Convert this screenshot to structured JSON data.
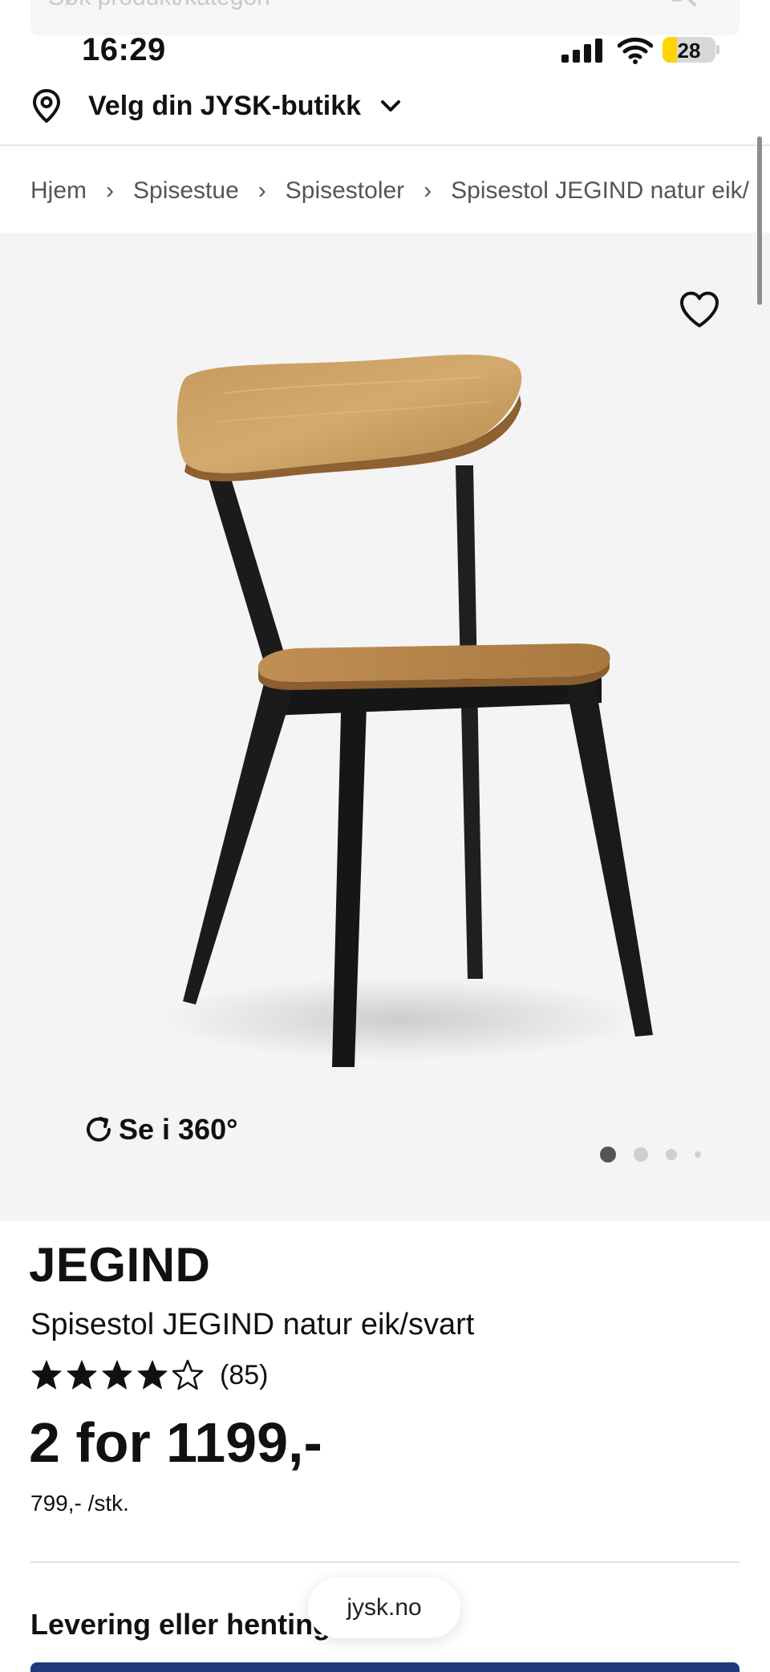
{
  "header": {
    "search_placeholder": "Søk produkt/kategori",
    "store_label": "Velg din JYSK-butikk"
  },
  "status_bar": {
    "time": "16:29",
    "battery": "28",
    "battery_level": 0.28
  },
  "breadcrumb": [
    {
      "label": "Hjem"
    },
    {
      "label": "Spisestue"
    },
    {
      "label": "Spisestoler"
    },
    {
      "label": "Spisestol JEGIND natur eik/"
    }
  ],
  "gallery": {
    "view360_label": "Se i 360°",
    "image_count": 4,
    "active_index": 0
  },
  "product": {
    "brand": "JEGIND",
    "name": "Spisestol JEGIND natur eik/svart",
    "rating": 4,
    "rating_max": 5,
    "rating_count": "(85)",
    "price": "2 for 1199,-",
    "unit_price": "799,- /stk."
  },
  "delivery": {
    "heading": "Levering eller henting"
  },
  "browser": {
    "url": "jysk.no"
  },
  "colors": {
    "gallery_bg": "#f4f4f4",
    "battery": "#ffd400",
    "cta": "#1e3a7b"
  }
}
